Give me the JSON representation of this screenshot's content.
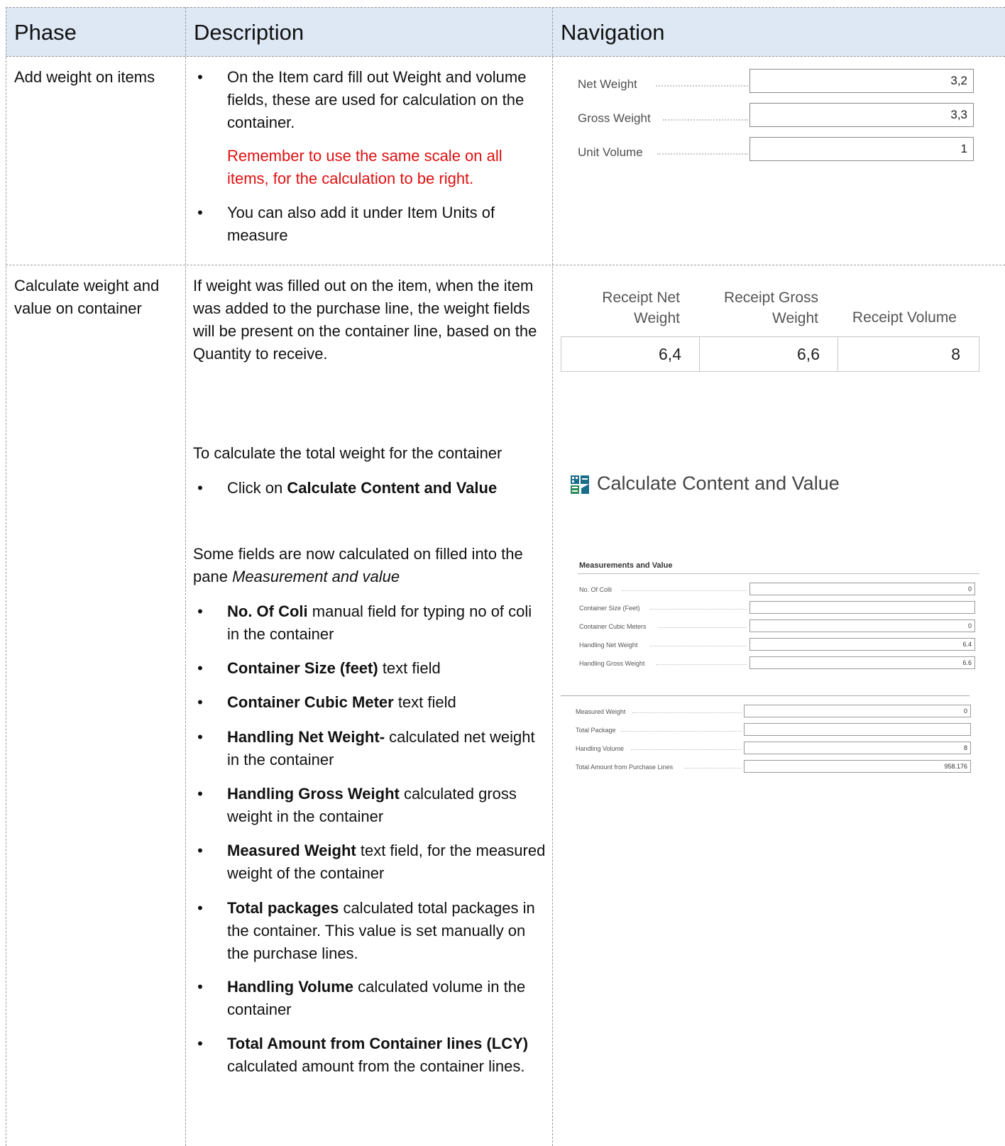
{
  "header": {
    "phase": "Phase",
    "description": "Description",
    "navigation": "Navigation"
  },
  "row1": {
    "phase": "Add weight on items",
    "bullet1": "On the Item card fill out Weight and volume fields, these are used for calculation on the container.",
    "warning": "Remember to use the same scale on all items, for the calculation to be right.",
    "bullet2": "You can also add it under Item Units of measure",
    "fields": [
      {
        "label": "Net Weight",
        "value": "3,2"
      },
      {
        "label": "Gross Weight",
        "value": "3,3"
      },
      {
        "label": "Unit Volume",
        "value": "1"
      }
    ]
  },
  "row2": {
    "phase": "Calculate weight and value on container",
    "para1": "If weight was filled out on the item, when the item was added to the purchase line, the weight fields will be present on the container line, based on the Quantity to receive.",
    "para2": "To calculate the total weight for the container",
    "click_prefix": "Click on ",
    "click_bold": "Calculate Content and Value",
    "para3_a": "Some fields are now calculated on filled into the pane ",
    "para3_b": "Measurement and value",
    "bullets": [
      {
        "bold": "No. Of Coli",
        "text": " manual field for typing no of coli in the container"
      },
      {
        "bold": "Container Size (feet)",
        "text": " text field"
      },
      {
        "bold": "Container Cubic Meter",
        "text": " text field"
      },
      {
        "bold": "Handling Net Weight-",
        "text": " calculated net weight in the container"
      },
      {
        "bold": "Handling Gross Weight",
        "text": " calculated gross weight in the container"
      },
      {
        "bold": "Measured Weight",
        "text": " text field, for the measured weight of the container"
      },
      {
        "bold": "Total packages",
        "text": " calculated total packages in the container. This value is set manually on the purchase lines."
      },
      {
        "bold": "Handling Volume",
        "text": " calculated volume in the container"
      },
      {
        "bold": "Total Amount from Container lines (LCY)",
        "text": " calculated amount from the container lines."
      }
    ],
    "receipt": {
      "headers": [
        "Receipt Net Weight",
        "Receipt Gross Weight",
        "Receipt Volume"
      ],
      "values": [
        "6,4",
        "6,6",
        "8"
      ]
    },
    "action_label": "Calculate Content and Value",
    "pane_title": "Measurements and Value",
    "pane_fields": [
      {
        "label": "No. Of Colli",
        "value": "0"
      },
      {
        "label": "Container Size (Feet)",
        "value": ""
      },
      {
        "label": "Container Cubic Meters",
        "value": "0"
      },
      {
        "label": "Handling Net Weight",
        "value": "6.4"
      },
      {
        "label": "Handling Gross Weight",
        "value": "6.6"
      }
    ],
    "pane_fields2": [
      {
        "label": "Measured Weight",
        "value": "0"
      },
      {
        "label": "Total Package",
        "value": ""
      },
      {
        "label": "Handling Volume",
        "value": "8"
      },
      {
        "label": "Total Amount from Purchase Lines",
        "value": "958.176"
      }
    ]
  }
}
